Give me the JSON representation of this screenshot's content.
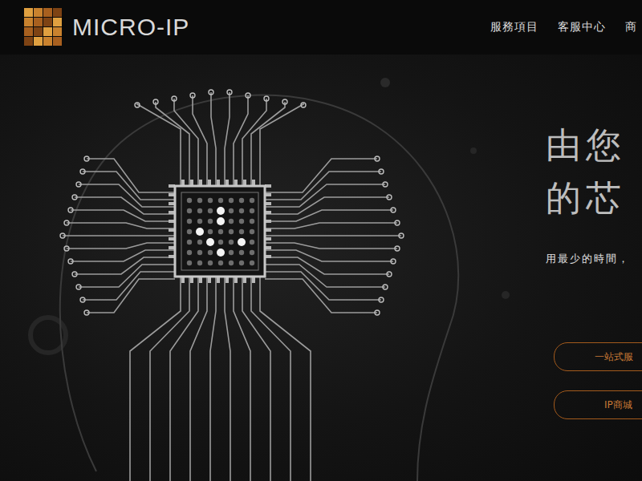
{
  "logo": {
    "text": "MICRO-IP"
  },
  "nav": [
    "服務項目",
    "客服中心",
    "商"
  ],
  "hero": {
    "title_lines": [
      "由您",
      "的芯"
    ],
    "subtitle": "用最少的時間，",
    "buttons": [
      "一站式服",
      "IP商城"
    ]
  }
}
